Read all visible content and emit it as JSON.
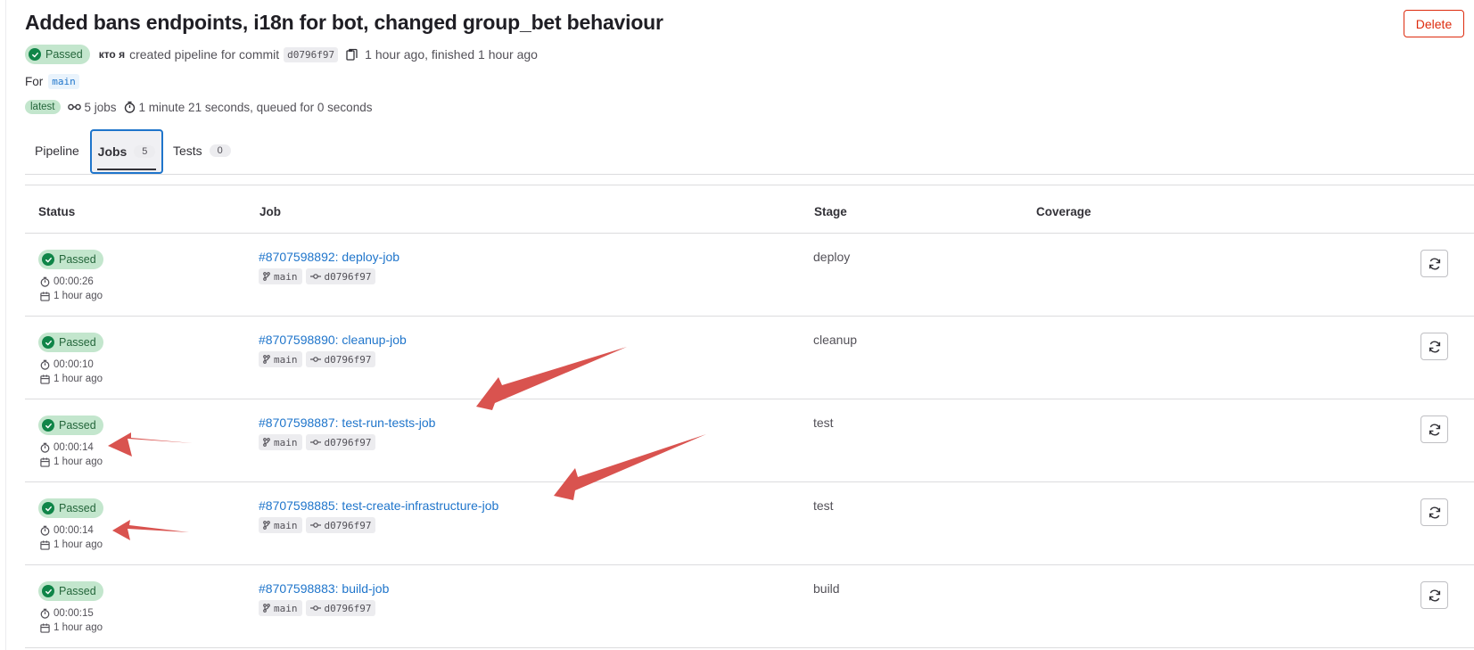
{
  "header": {
    "title": "Added bans endpoints, i18n for bot, changed group_bet behaviour",
    "delete_label": "Delete",
    "status": "Passed",
    "author": "кто я",
    "created_text": "created pipeline for commit",
    "commit": "d0796f97",
    "time_text": "1 hour ago, finished 1 hour ago",
    "for_label": "For",
    "branch": "main",
    "latest_label": "latest",
    "jobs_count_text": "5 jobs",
    "duration_text": "1 minute 21 seconds, queued for 0 seconds"
  },
  "tabs": [
    {
      "label": "Pipeline",
      "count": null
    },
    {
      "label": "Jobs",
      "count": "5"
    },
    {
      "label": "Tests",
      "count": "0"
    }
  ],
  "table": {
    "headers": [
      "Status",
      "Job",
      "Stage",
      "Coverage"
    ],
    "rows": [
      {
        "status": "Passed",
        "duration": "00:00:26",
        "ago": "1 hour ago",
        "job": "#8707598892: deploy-job",
        "branch": "main",
        "commit": "d0796f97",
        "stage": "deploy"
      },
      {
        "status": "Passed",
        "duration": "00:00:10",
        "ago": "1 hour ago",
        "job": "#8707598890: cleanup-job",
        "branch": "main",
        "commit": "d0796f97",
        "stage": "cleanup"
      },
      {
        "status": "Passed",
        "duration": "00:00:14",
        "ago": "1 hour ago",
        "job": "#8707598887: test-run-tests-job",
        "branch": "main",
        "commit": "d0796f97",
        "stage": "test"
      },
      {
        "status": "Passed",
        "duration": "00:00:14",
        "ago": "1 hour ago",
        "job": "#8707598885: test-create-infrastructure-job",
        "branch": "main",
        "commit": "d0796f97",
        "stage": "test"
      },
      {
        "status": "Passed",
        "duration": "00:00:15",
        "ago": "1 hour ago",
        "job": "#8707598883: build-job",
        "branch": "main",
        "commit": "d0796f97",
        "stage": "build"
      }
    ]
  },
  "colors": {
    "passed_bg": "#c3e6cd",
    "passed_text": "#24663b",
    "passed_icon": "#108548",
    "link": "#1f75cb",
    "delete": "#dd2b0e",
    "annotation_arrow": "#d9534f"
  },
  "icons": [
    "check-circle-icon",
    "copy-icon",
    "pipeline-icon",
    "timer-icon",
    "calendar-icon",
    "branch-icon",
    "commit-icon",
    "retry-icon"
  ]
}
